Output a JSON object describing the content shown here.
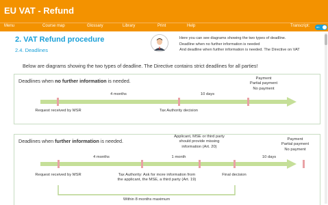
{
  "app": {
    "title": "EU VAT - Refund",
    "nav": [
      "Menu",
      "Course map",
      "Glossary",
      "Library",
      "Print",
      "Help"
    ],
    "transcript_label": "Transcript:",
    "transcript_toggle": "on"
  },
  "header": {
    "section_title": "2. VAT Refund procedure",
    "section_sub": "2.4. Deadlines",
    "speech": [
      "Here you can see diagrams showing the two types of deadline.",
      "Deadline when no further information is needed",
      "And deadline when further information is needed. The Directive on VAT"
    ]
  },
  "intro": "Below are diagrams showing the two types of deadline. The Directive contains strict deadlines for all parties!",
  "diagram1": {
    "heading_pre": "Deadlines when ",
    "heading_bold": "no further information",
    "heading_post": " is needed.",
    "period_4m": "4 months",
    "period_10d": "10 days",
    "outcome": [
      "Payment",
      "Partial payment",
      "No payment"
    ],
    "request": "Request received by MSR",
    "decision": "Tax Authority decision"
  },
  "diagram2": {
    "heading_pre": "Deadlines when ",
    "heading_bold": "further information",
    "heading_post": " is needed.",
    "applicant": [
      "Applicant, MSE or third party",
      "should provide missing",
      "information (Art. 20)"
    ],
    "outcome": [
      "Payment",
      "Partial payment",
      "No payment"
    ],
    "period_4m": "4 months",
    "period_1m": "1 month",
    "period_10d": "10 days",
    "request": "Request received by MSR",
    "ask": [
      "Tax Authority: Ask for more information from",
      "the applicant, the MSE, a third party (Art. 19)"
    ],
    "final": "Final decision",
    "within": "Within 8 months maximum"
  },
  "colors": {
    "brand_orange": "#f39200",
    "accent_blue": "#1aa0d8",
    "arrow_green": "#c5df98",
    "tick_pink": "#e9a1a5",
    "bracket_green": "#b5d38c"
  }
}
